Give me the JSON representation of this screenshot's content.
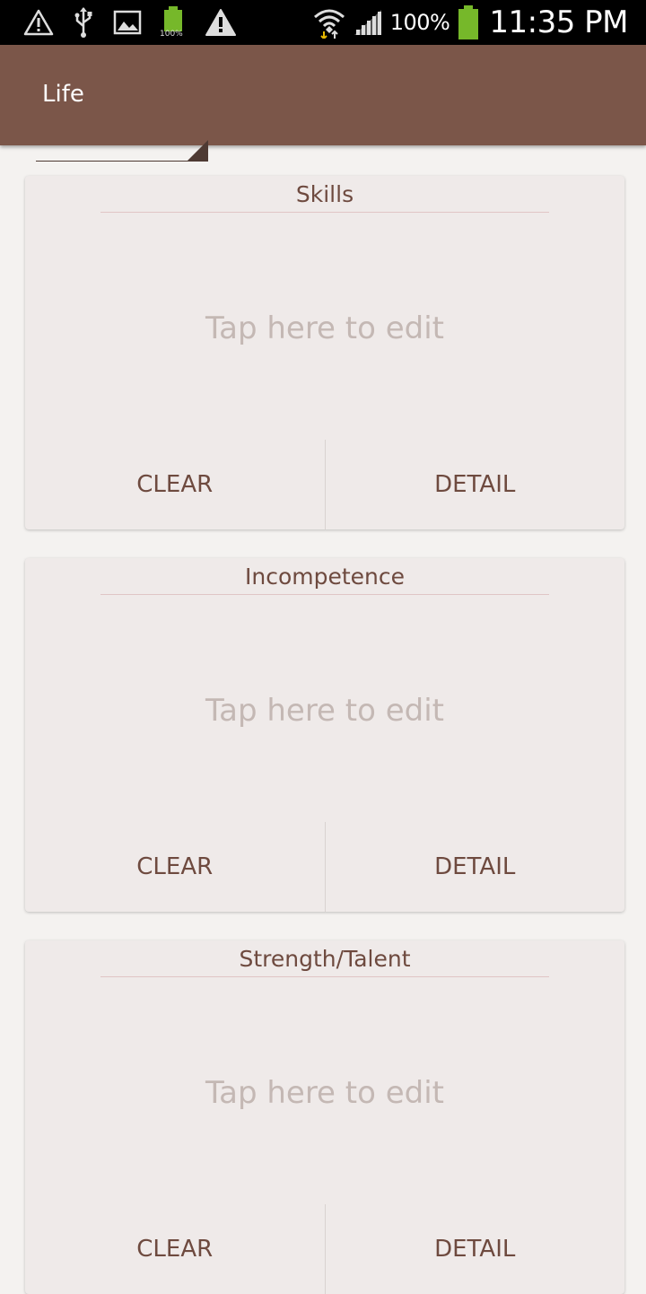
{
  "status_bar": {
    "left_icons": [
      "warning-icon",
      "usb-icon",
      "image-icon",
      "battery-full-icon",
      "alert-icon"
    ],
    "mini_battery_label": "100%",
    "battery_percent": "100%",
    "time": "11:35 PM"
  },
  "toolbar": {
    "spinner_value": "Life"
  },
  "cards": [
    {
      "title": "Skills",
      "placeholder": "Tap here to edit",
      "clear_label": "CLEAR",
      "detail_label": "DETAIL"
    },
    {
      "title": "Incompetence",
      "placeholder": "Tap here to edit",
      "clear_label": "CLEAR",
      "detail_label": "DETAIL"
    },
    {
      "title": "Strength/Talent",
      "placeholder": "Tap here to edit",
      "clear_label": "CLEAR",
      "detail_label": "DETAIL"
    }
  ],
  "colors": {
    "toolbar": "#7b5649",
    "card_bg": "#efeae9",
    "accent_text": "#6e4a3f",
    "placeholder_text": "#c4b8b4",
    "battery_green": "#76b82a"
  }
}
